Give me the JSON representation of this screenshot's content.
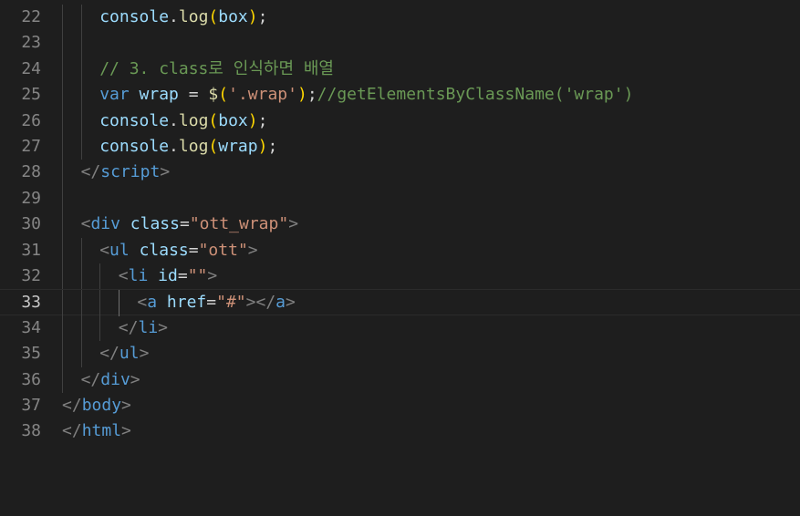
{
  "editor": {
    "current_line": 33,
    "lines": [
      {
        "number": "22",
        "indent": 2,
        "tokens": [
          {
            "t": "console",
            "c": "var"
          },
          {
            "t": ".",
            "c": "plain"
          },
          {
            "t": "log",
            "c": "fn"
          },
          {
            "t": "(",
            "c": "brk1"
          },
          {
            "t": "box",
            "c": "var"
          },
          {
            "t": ")",
            "c": "brk1"
          },
          {
            "t": ";",
            "c": "plain"
          }
        ]
      },
      {
        "number": "23",
        "indent": 0,
        "tokens": []
      },
      {
        "number": "24",
        "indent": 2,
        "tokens": [
          {
            "t": "// 3. class로 인식하면 배열",
            "c": "comment"
          }
        ]
      },
      {
        "number": "25",
        "indent": 2,
        "tokens": [
          {
            "t": "var",
            "c": "kw"
          },
          {
            "t": " ",
            "c": "plain"
          },
          {
            "t": "wrap",
            "c": "var"
          },
          {
            "t": " = ",
            "c": "plain"
          },
          {
            "t": "$",
            "c": "fn"
          },
          {
            "t": "(",
            "c": "brk1"
          },
          {
            "t": "'.wrap'",
            "c": "str"
          },
          {
            "t": ")",
            "c": "brk1"
          },
          {
            "t": ";",
            "c": "plain"
          },
          {
            "t": "//getElementsByClassName('wrap')",
            "c": "comment"
          }
        ]
      },
      {
        "number": "26",
        "indent": 2,
        "tokens": [
          {
            "t": "console",
            "c": "var"
          },
          {
            "t": ".",
            "c": "plain"
          },
          {
            "t": "log",
            "c": "fn"
          },
          {
            "t": "(",
            "c": "brk1"
          },
          {
            "t": "box",
            "c": "var"
          },
          {
            "t": ")",
            "c": "brk1"
          },
          {
            "t": ";",
            "c": "plain"
          }
        ]
      },
      {
        "number": "27",
        "indent": 2,
        "tokens": [
          {
            "t": "console",
            "c": "var"
          },
          {
            "t": ".",
            "c": "plain"
          },
          {
            "t": "log",
            "c": "fn"
          },
          {
            "t": "(",
            "c": "brk1"
          },
          {
            "t": "wrap",
            "c": "var"
          },
          {
            "t": ")",
            "c": "brk1"
          },
          {
            "t": ";",
            "c": "plain"
          }
        ]
      },
      {
        "number": "28",
        "indent": 1,
        "tokens": [
          {
            "t": "</",
            "c": "punc"
          },
          {
            "t": "script",
            "c": "tag"
          },
          {
            "t": ">",
            "c": "punc"
          }
        ]
      },
      {
        "number": "29",
        "indent": 0,
        "tokens": []
      },
      {
        "number": "30",
        "indent": 1,
        "tokens": [
          {
            "t": "<",
            "c": "punc"
          },
          {
            "t": "div",
            "c": "tag"
          },
          {
            "t": " ",
            "c": "plain"
          },
          {
            "t": "class",
            "c": "attr"
          },
          {
            "t": "=",
            "c": "plain"
          },
          {
            "t": "\"ott_wrap\"",
            "c": "str"
          },
          {
            "t": ">",
            "c": "punc"
          }
        ]
      },
      {
        "number": "31",
        "indent": 2,
        "tokens": [
          {
            "t": "<",
            "c": "punc"
          },
          {
            "t": "ul",
            "c": "tag"
          },
          {
            "t": " ",
            "c": "plain"
          },
          {
            "t": "class",
            "c": "attr"
          },
          {
            "t": "=",
            "c": "plain"
          },
          {
            "t": "\"ott\"",
            "c": "str"
          },
          {
            "t": ">",
            "c": "punc"
          }
        ]
      },
      {
        "number": "32",
        "indent": 3,
        "tokens": [
          {
            "t": "<",
            "c": "punc"
          },
          {
            "t": "li",
            "c": "tag"
          },
          {
            "t": " ",
            "c": "plain"
          },
          {
            "t": "id",
            "c": "attr"
          },
          {
            "t": "=",
            "c": "plain"
          },
          {
            "t": "\"\"",
            "c": "str"
          },
          {
            "t": ">",
            "c": "punc"
          }
        ]
      },
      {
        "number": "33",
        "indent": 4,
        "tokens": [
          {
            "t": "<",
            "c": "punc"
          },
          {
            "t": "a",
            "c": "tag"
          },
          {
            "t": " ",
            "c": "plain"
          },
          {
            "t": "href",
            "c": "attr"
          },
          {
            "t": "=",
            "c": "plain"
          },
          {
            "t": "\"#\"",
            "c": "str"
          },
          {
            "t": "></",
            "c": "punc"
          },
          {
            "t": "a",
            "c": "tag"
          },
          {
            "t": ">",
            "c": "punc"
          }
        ]
      },
      {
        "number": "34",
        "indent": 3,
        "tokens": [
          {
            "t": "</",
            "c": "punc"
          },
          {
            "t": "li",
            "c": "tag"
          },
          {
            "t": ">",
            "c": "punc"
          }
        ]
      },
      {
        "number": "35",
        "indent": 2,
        "tokens": [
          {
            "t": "</",
            "c": "punc"
          },
          {
            "t": "ul",
            "c": "tag"
          },
          {
            "t": ">",
            "c": "punc"
          }
        ]
      },
      {
        "number": "36",
        "indent": 1,
        "tokens": [
          {
            "t": "</",
            "c": "punc"
          },
          {
            "t": "div",
            "c": "tag"
          },
          {
            "t": ">",
            "c": "punc"
          }
        ]
      },
      {
        "number": "37",
        "indent": 0,
        "tokens": [
          {
            "t": "</",
            "c": "punc"
          },
          {
            "t": "body",
            "c": "tag"
          },
          {
            "t": ">",
            "c": "punc"
          }
        ]
      },
      {
        "number": "38",
        "indent": 0,
        "tokens": [
          {
            "t": "</",
            "c": "punc"
          },
          {
            "t": "html",
            "c": "tag"
          },
          {
            "t": ">",
            "c": "punc"
          }
        ]
      }
    ]
  }
}
